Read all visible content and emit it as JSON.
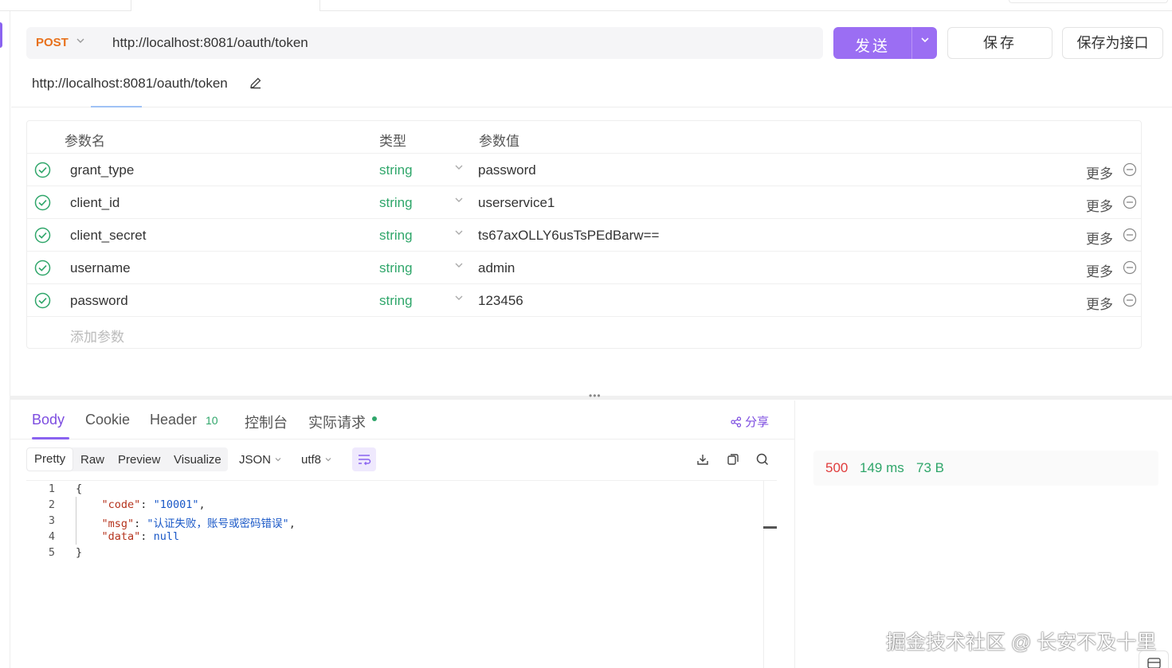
{
  "request": {
    "method": "POST",
    "url": "http://localhost:8081/oauth/token",
    "url_display": "http://localhost:8081/oauth/token",
    "send_label": "发送",
    "save_label": "保存",
    "save_as_api_label": "保存为接口"
  },
  "params": {
    "headers": {
      "name": "参数名",
      "type": "类型",
      "value": "参数值"
    },
    "rows": [
      {
        "name": "grant_type",
        "type": "string",
        "value": "password",
        "more": "更多"
      },
      {
        "name": "client_id",
        "type": "string",
        "value": "userservice1",
        "more": "更多"
      },
      {
        "name": "client_secret",
        "type": "string",
        "value": "ts67axOLLY6usTsPEdBarw==",
        "more": "更多"
      },
      {
        "name": "username",
        "type": "string",
        "value": "admin",
        "more": "更多"
      },
      {
        "name": "password",
        "type": "string",
        "value": "123456",
        "more": "更多"
      }
    ],
    "add_placeholder": "添加参数"
  },
  "response": {
    "tabs": {
      "body": "Body",
      "cookie": "Cookie",
      "header": "Header",
      "header_count": "10",
      "console": "控制台",
      "actual": "实际请求"
    },
    "share": "分享",
    "views": {
      "pretty": "Pretty",
      "raw": "Raw",
      "preview": "Preview",
      "visualize": "Visualize"
    },
    "format": "JSON",
    "encoding": "utf8",
    "code": {
      "line_numbers": [
        "1",
        "2",
        "3",
        "4",
        "5"
      ],
      "open": "{",
      "close": "}",
      "k_code": "\"code\"",
      "v_code": "\"10001\"",
      "k_msg": "\"msg\"",
      "v_msg": "\"认证失败，账号或密码错误\"",
      "k_data": "\"data\"",
      "v_data": "null"
    },
    "status": {
      "code": "500",
      "time": "149 ms",
      "size": "73 B"
    }
  },
  "watermark": "掘金技术社区 @ 长安不及十里",
  "colors": {
    "accent": "#9b6ef3",
    "method": "#e8711c",
    "type": "#2fa66a",
    "error": "#e03c3c"
  }
}
